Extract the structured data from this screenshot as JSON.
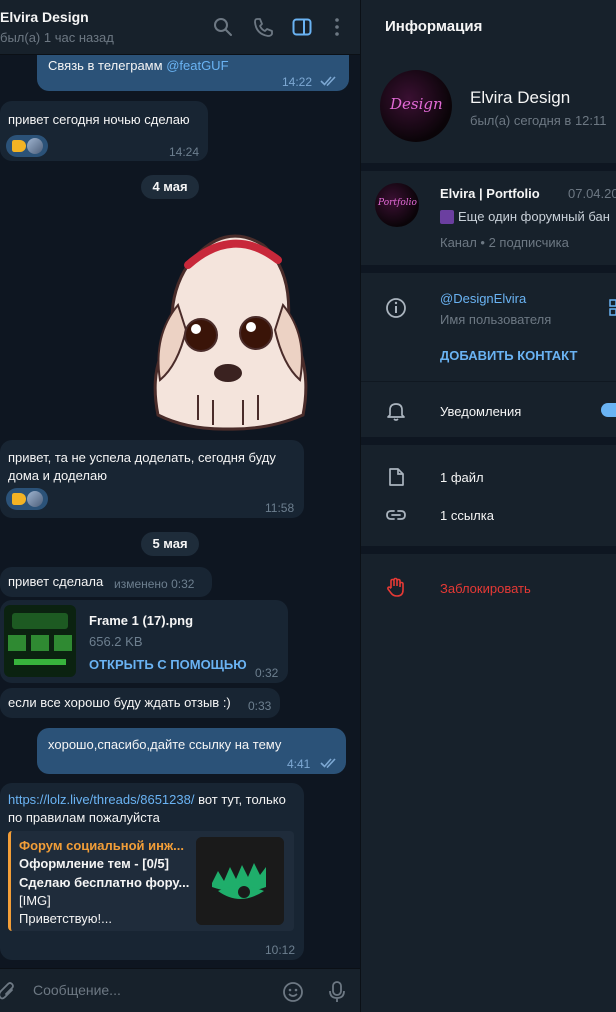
{
  "chat": {
    "title": "Elvira Design",
    "status": "был(а) 1 час назад",
    "header_icons": [
      "search-icon",
      "phone-icon",
      "sidebar-toggle-icon",
      "more-vertical-icon"
    ],
    "messages": [
      {
        "dir": "out",
        "text": "Связь в телеграмм",
        "link": "@featGUF",
        "time": "14:22",
        "read": true
      },
      {
        "dir": "in",
        "text": "привет сегодня ночью сделаю",
        "time": "14:24",
        "reaction": "handshake-reaction"
      },
      {
        "type": "date",
        "text": "4 мая"
      },
      {
        "dir": "in",
        "type": "sticker",
        "sticker": "sad-puppy-sticker"
      },
      {
        "dir": "in",
        "text": "привет, та не успела доделать, сегодня буду дома и доделаю",
        "time": "11:58",
        "reaction": "handshake-reaction"
      },
      {
        "type": "date",
        "text": "5 мая"
      },
      {
        "dir": "in",
        "text": "привет сделала",
        "edited": "изменено",
        "time": "0:32"
      },
      {
        "dir": "in",
        "type": "file",
        "file_name": "Frame 1 (17).png",
        "file_size": "656.2 KB",
        "action": "ОТКРЫТЬ С ПОМОЩЬЮ",
        "time": "0:32"
      },
      {
        "dir": "in",
        "text": "если все хорошо буду ждать отзыв :)",
        "time": "0:33"
      },
      {
        "dir": "out",
        "text": "хорошо,спасибо,дайте ссылку на тему",
        "time": "4:41",
        "read": true
      },
      {
        "dir": "in",
        "link": "https://lolz.live/threads/8651238/",
        "text": " вот тут, только по правилам пожалуйста",
        "time": "10:12",
        "preview": {
          "title": "Форум социальной инж...",
          "line1": "Оформление тем - [0/5]",
          "line2": "Сделаю бесплатно фору...",
          "line3": "[IMG]",
          "line4": "Приветствую!..."
        }
      }
    ],
    "composer_placeholder": "Сообщение..."
  },
  "info": {
    "header": "Информация",
    "profile_name": "Elvira Design",
    "profile_status": "был(а) сегодня в 12:11",
    "avatar_text": "Design",
    "channel": {
      "name": "Elvira | Portfolio",
      "date": "07.04.20",
      "preview": "Еще один форумный бан",
      "subs": "Канал • 2 подписчика",
      "avatar_text": "Portfolio"
    },
    "username": "@DesignElvira",
    "username_label": "Имя пользователя",
    "add_contact": "ДОБАВИТЬ КОНТАКТ",
    "notifications": "Уведомления",
    "notifications_on": true,
    "files": "1 файл",
    "links": "1 ссылка",
    "block": "Заблокировать"
  },
  "colors": {
    "accent": "#6ab3f3",
    "danger": "#e53935",
    "out_bubble": "#2b5278",
    "in_bubble": "#182533",
    "panel": "#17212b",
    "bg": "#0e1621"
  }
}
